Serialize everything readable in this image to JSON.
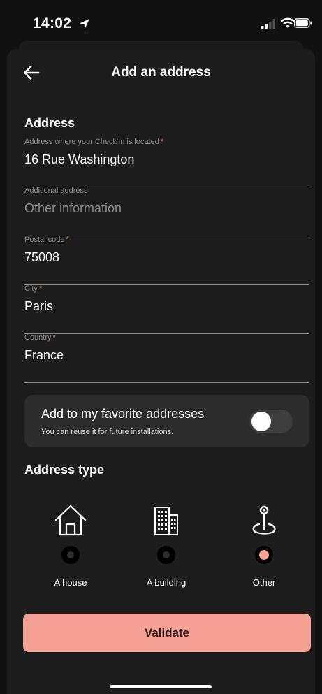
{
  "status_bar": {
    "time": "14:02",
    "icons": [
      "location-arrow-icon",
      "signal-icon",
      "wifi-icon",
      "battery-icon"
    ]
  },
  "header": {
    "title": "Add an address",
    "back_icon": "arrow-left-icon"
  },
  "address_section": {
    "title": "Address",
    "fields": [
      {
        "label": "Address where your Check'In is located",
        "required": true,
        "value": "16 Rue Washington",
        "placeholder": ""
      },
      {
        "label": "Additional address",
        "required": false,
        "value": "",
        "placeholder": "Other information"
      },
      {
        "label": "Postal code",
        "required": true,
        "value": "75008",
        "placeholder": ""
      },
      {
        "label": "City",
        "required": true,
        "value": "Paris",
        "placeholder": ""
      },
      {
        "label": "Country",
        "required": true,
        "value": "France",
        "placeholder": ""
      }
    ],
    "required_marker": "*"
  },
  "favorite": {
    "title": "Add to my favorite addresses",
    "subtitle": "You can reuse it for future installations.",
    "enabled": false
  },
  "address_type": {
    "title": "Address type",
    "options": [
      {
        "label": "A house",
        "icon": "house-icon",
        "selected": false
      },
      {
        "label": "A building",
        "icon": "building-icon",
        "selected": false
      },
      {
        "label": "Other",
        "icon": "map-pin-icon",
        "selected": true
      }
    ]
  },
  "validate_label": "Validate",
  "colors": {
    "accent": "#f5a193",
    "background": "#1d1d1d",
    "card": "#2c2c2c"
  }
}
